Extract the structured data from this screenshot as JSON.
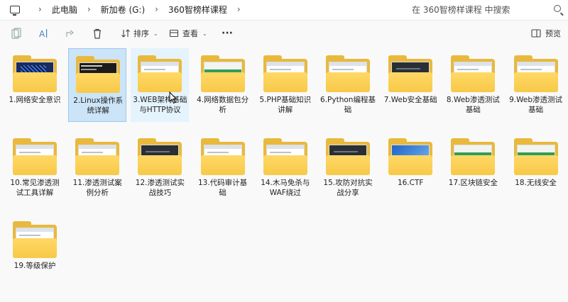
{
  "address": {
    "crumbs": [
      "此电脑",
      "新加卷 (G:)",
      "360智榜样课程"
    ],
    "search_placeholder": "在 360智榜样课程 中搜索"
  },
  "toolbar": {
    "sort_label": "排序",
    "view_label": "查看",
    "more_label": "···",
    "preview_label": "预览"
  },
  "folders": [
    {
      "label": "1.网络安全意识",
      "thumb": "dark-blue"
    },
    {
      "label": "2.Linux操作系统详解",
      "thumb": "terminal"
    },
    {
      "label": "3.WEB架构基础与HTTP协议",
      "thumb": "web"
    },
    {
      "label": "4.网络数据包分析",
      "thumb": "green"
    },
    {
      "label": "5.PHP基础知识讲解",
      "thumb": "web"
    },
    {
      "label": "6.Python编程基础",
      "thumb": "web"
    },
    {
      "label": "7.Web安全基础",
      "thumb": "dark"
    },
    {
      "label": "8.Web渗透测试基础",
      "thumb": "web"
    },
    {
      "label": "9.Web渗透测试基础",
      "thumb": "web"
    },
    {
      "label": "10.常见渗透测试工具详解",
      "thumb": "web"
    },
    {
      "label": "11.渗透测试案例分析",
      "thumb": "web"
    },
    {
      "label": "12.渗透测试实战技巧",
      "thumb": "dark"
    },
    {
      "label": "13.代码审计基础",
      "thumb": "web"
    },
    {
      "label": "14.木马免杀与WAF绕过",
      "thumb": "web"
    },
    {
      "label": "15.攻防对抗实战分享",
      "thumb": "dark"
    },
    {
      "label": "16.CTF",
      "thumb": "desktop"
    },
    {
      "label": "17.区块链安全",
      "thumb": "green"
    },
    {
      "label": "18.无线安全",
      "thumb": "green"
    },
    {
      "label": "19.等级保护",
      "thumb": "web"
    }
  ],
  "selected_index": 1,
  "hover_index": 2
}
